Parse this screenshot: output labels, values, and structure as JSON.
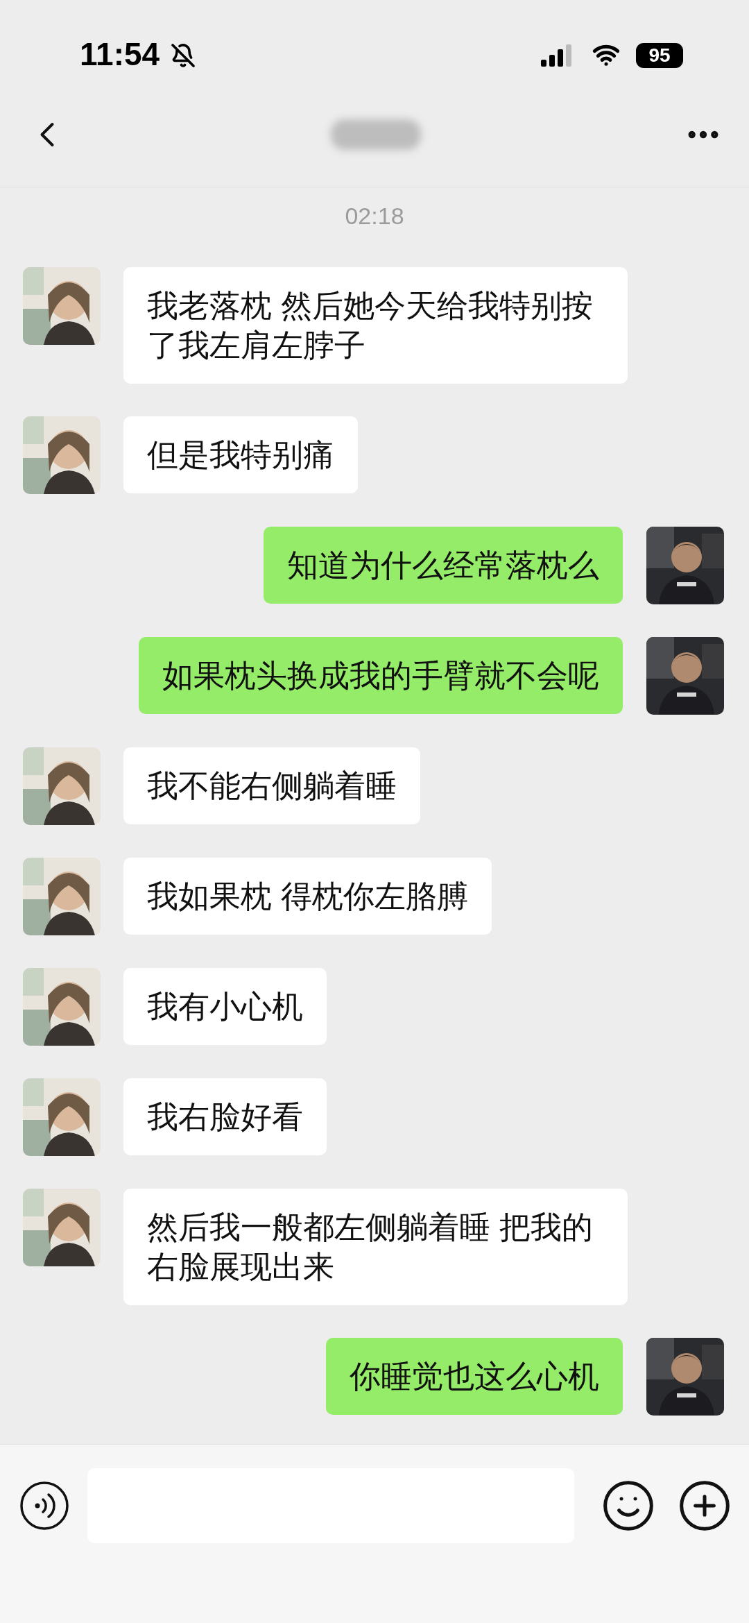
{
  "status_bar": {
    "time": "11:54",
    "battery": "95"
  },
  "chat": {
    "timestamp": "02:18",
    "messages": [
      {
        "kind": "received",
        "text": "我老落枕 然后她今天给我特别按了我左肩左脖子"
      },
      {
        "kind": "received",
        "text": "但是我特别痛"
      },
      {
        "kind": "sent",
        "text": "知道为什么经常落枕么"
      },
      {
        "kind": "sent",
        "text": "如果枕头换成我的手臂就不会呢"
      },
      {
        "kind": "received",
        "text": "我不能右侧躺着睡"
      },
      {
        "kind": "received",
        "text": "我如果枕 得枕你左胳膊"
      },
      {
        "kind": "received",
        "text": "我有小心机"
      },
      {
        "kind": "received",
        "text": "我右脸好看"
      },
      {
        "kind": "received",
        "text": "然后我一般都左侧躺着睡 把我的右脸展现出来"
      },
      {
        "kind": "sent",
        "text": "你睡觉也这么心机"
      }
    ]
  }
}
